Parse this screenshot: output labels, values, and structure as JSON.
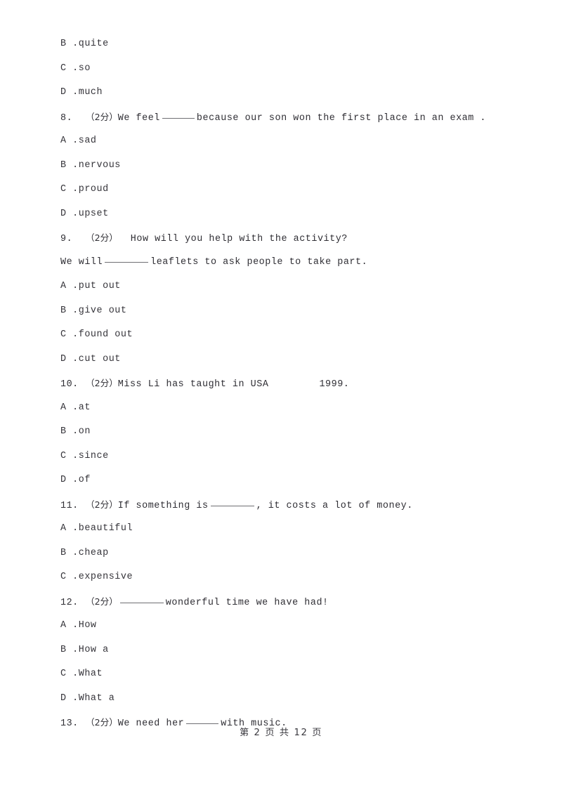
{
  "document": {
    "type": "exam-paper",
    "footer": {
      "prefix": "第",
      "page_number": "2",
      "middle": "页 共",
      "total_pages": "12",
      "suffix": "页",
      "full_text": "第 2 页 共 12 页"
    }
  },
  "carryover_options": [
    {
      "letter": "B .",
      "text": "quite"
    },
    {
      "letter": "C .",
      "text": "so"
    },
    {
      "letter": "D .",
      "text": "much"
    }
  ],
  "questions": [
    {
      "number": "8.",
      "marks": "（2分）",
      "stem_before": "We feel",
      "blank": "____",
      "stem_after": "because our son won the first place in an exam .",
      "options": [
        {
          "letter": "A .",
          "text": "sad"
        },
        {
          "letter": "B .",
          "text": "nervous"
        },
        {
          "letter": "C .",
          "text": "proud"
        },
        {
          "letter": "D .",
          "text": "upset"
        }
      ]
    },
    {
      "number": "9.",
      "marks": "（2分）",
      "stem_line1": "How will you help with the activity?",
      "stem_line2_before": "We will",
      "stem_line2_after": "leaflets to ask people to take part.",
      "options": [
        {
          "letter": "A .",
          "text": "put out"
        },
        {
          "letter": "B .",
          "text": "give out"
        },
        {
          "letter": "C .",
          "text": "found out"
        },
        {
          "letter": "D .",
          "text": "cut out"
        }
      ]
    },
    {
      "number": "10.",
      "marks": "（2分）",
      "stem_before": "Miss Li has taught in USA",
      "stem_after": "1999.",
      "options": [
        {
          "letter": "A .",
          "text": "at"
        },
        {
          "letter": "B .",
          "text": "on"
        },
        {
          "letter": "C .",
          "text": "since"
        },
        {
          "letter": "D .",
          "text": "of"
        }
      ]
    },
    {
      "number": "11.",
      "marks": "（2分）",
      "stem_before": "If something is",
      "stem_after": ", it costs a lot of money.",
      "options": [
        {
          "letter": "A .",
          "text": "beautiful"
        },
        {
          "letter": "B .",
          "text": "cheap"
        },
        {
          "letter": "C .",
          "text": "expensive"
        }
      ]
    },
    {
      "number": "12.",
      "marks": "（2分）",
      "stem_before": "",
      "stem_after": "wonderful time we have had!",
      "options": [
        {
          "letter": "A .",
          "text": "How"
        },
        {
          "letter": "B .",
          "text": "How a"
        },
        {
          "letter": "C .",
          "text": "What"
        },
        {
          "letter": "D .",
          "text": "What a"
        }
      ]
    },
    {
      "number": "13.",
      "marks": "（2分）",
      "stem_before": "We need her",
      "stem_after": "with music.",
      "options": []
    }
  ]
}
